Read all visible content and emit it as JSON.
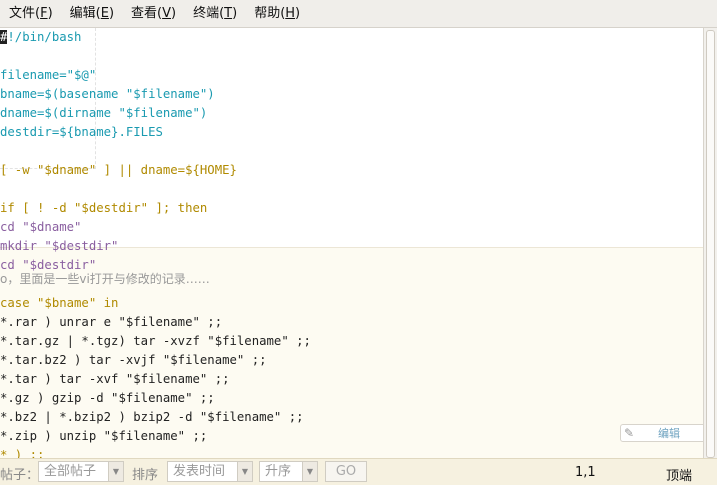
{
  "menubar": {
    "items": [
      {
        "label": "文件(",
        "key": "F",
        "end": ")"
      },
      {
        "label": "编辑(",
        "key": "E",
        "end": ")"
      },
      {
        "label": "查看(",
        "key": "V",
        "end": ")"
      },
      {
        "label": "终端(",
        "key": "T",
        "end": ")"
      },
      {
        "label": "帮助(",
        "key": "H",
        "end": ")"
      }
    ]
  },
  "editor": {
    "lines": [
      "#!/bin/bash",
      "",
      "filename=\"$@\"",
      "bname=$(basename \"$filename\")",
      "dname=$(dirname \"$filename\")",
      "destdir=${bname}.FILES",
      "",
      "[ -w \"$dname\" ] || dname=${HOME}",
      "",
      "if [ ! -d \"$destdir\" ]; then",
      "cd \"$dname\"",
      "mkdir \"$destdir\"",
      "cd \"$destdir\"",
      "case \"$bname\" in",
      "*.rar ) unrar e \"$filename\" ;;",
      "*.tar.gz | *.tgz) tar -xvzf \"$filename\" ;;",
      "*.tar.bz2 ) tar -xvjf \"$filename\" ;;",
      "*.tar ) tar -xvf \"$filename\" ;;",
      "*.gz ) gzip -d \"$filename\" ;;",
      "*.bz2 | *.bzip2 ) bzip2 -d \"$filename\" ;;",
      "*.zip ) unzip \"$filename\" ;;",
      "* ) ;;"
    ],
    "overlay_note": "o，里面是一些vi打开与修改的记录……"
  },
  "statusbar": {
    "posts_label": "帖子：",
    "filter_select": "全部帖子",
    "sort_label": "排序",
    "sort_select": "发表时间",
    "order_select": "升序",
    "go_label": "GO",
    "cursor_pos": "1,1",
    "scroll_pos": "顶端"
  },
  "edit_stamp": {
    "label": "编辑"
  }
}
